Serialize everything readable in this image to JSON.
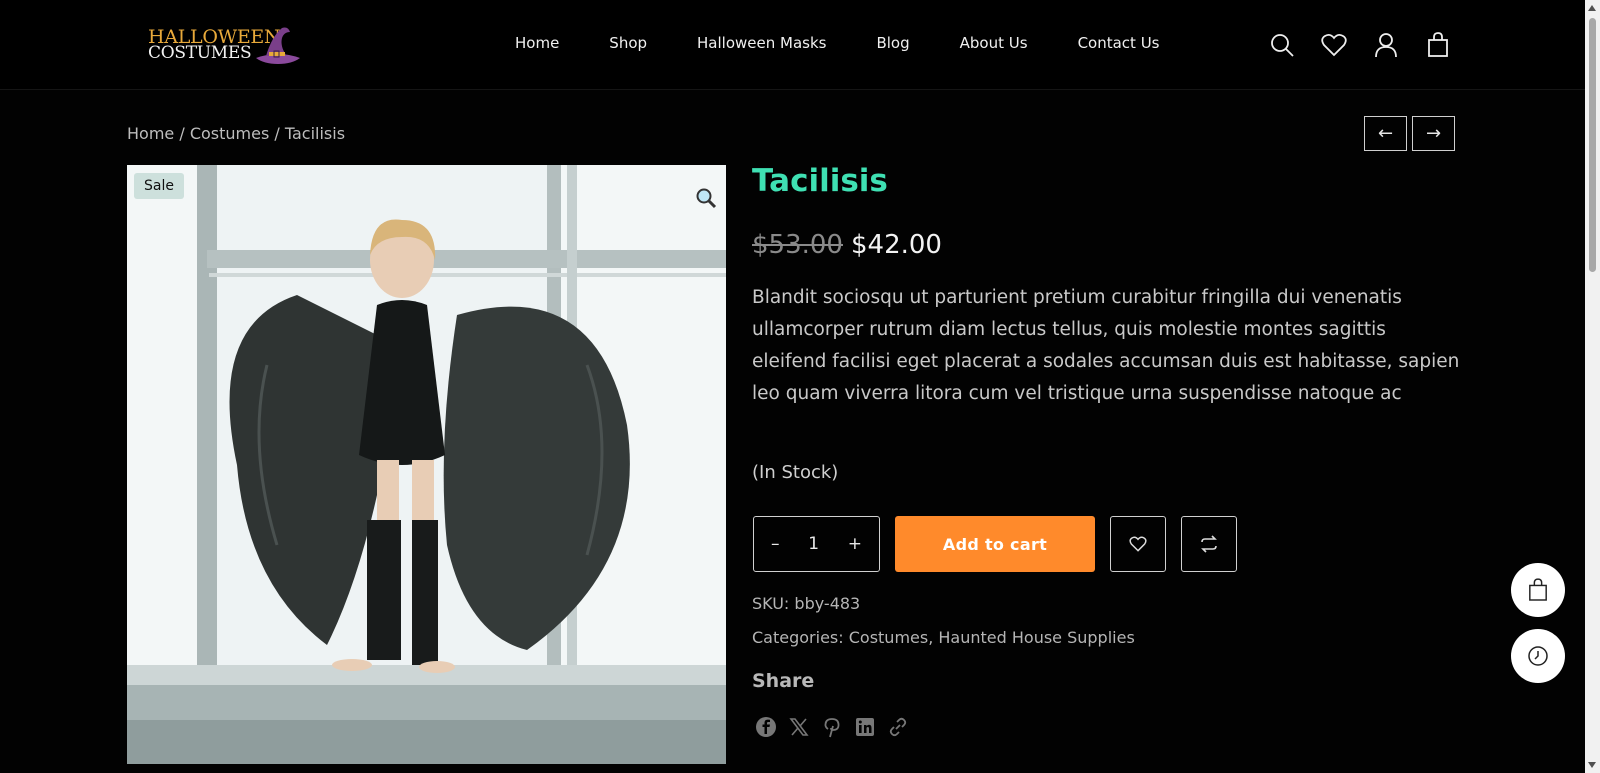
{
  "header": {
    "logo": {
      "line1": "HALLOWEEN",
      "line2": "COSTUMES"
    },
    "nav": [
      {
        "label": "Home"
      },
      {
        "label": "Shop"
      },
      {
        "label": "Halloween Masks"
      },
      {
        "label": "Blog"
      },
      {
        "label": "About Us"
      },
      {
        "label": "Contact Us"
      }
    ],
    "icons": [
      "search-icon",
      "heart-icon",
      "user-icon",
      "shopping-bag-icon"
    ]
  },
  "breadcrumb": {
    "items": [
      "Home",
      "Costumes",
      "Tacilisis"
    ],
    "separator": " / "
  },
  "pager": {
    "prev": "←",
    "next": "→"
  },
  "product": {
    "badge": "Sale",
    "title": "Tacilisis",
    "old_price": "$53.00",
    "price": "$42.00",
    "description": "Blandit sociosqu ut parturient pretium curabitur fringilla dui venenatis ullamcorper rutrum diam lectus tellus, quis molestie montes sagittis eleifend facilisi eget placerat a sodales accumsan duis est habitasse, sapien leo quam viverra litora cum vel tristique urna suspendisse natoque ac",
    "stock": "(In Stock)",
    "quantity": "1",
    "qty_minus": "–",
    "qty_plus": "+",
    "add_to_cart": "Add to cart",
    "sku_label": "SKU:",
    "sku": "bby-483",
    "categories_label": "Categories:",
    "categories": [
      "Costumes",
      "Haunted House Supplies"
    ],
    "share_label": "Share",
    "share_icons": [
      "facebook-icon",
      "x-icon",
      "pinterest-icon",
      "linkedin-icon",
      "link-icon"
    ]
  },
  "colors": {
    "accent_title": "#3fe0b3",
    "cart_button": "#ff8a2b",
    "background": "#020202"
  }
}
